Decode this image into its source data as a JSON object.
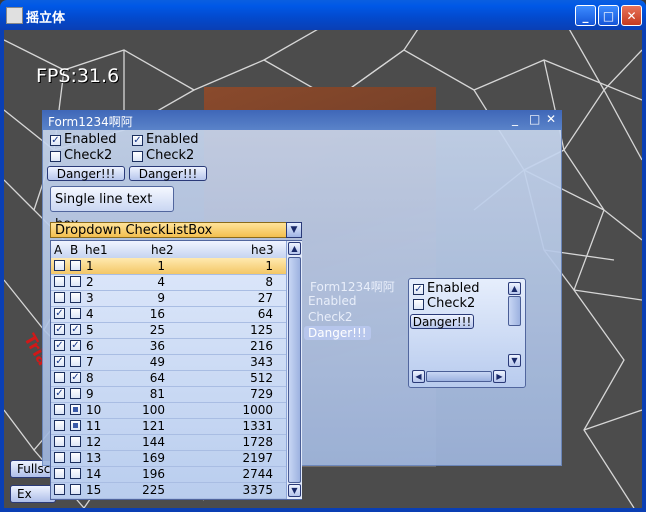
{
  "window": {
    "title": "摇立体",
    "min": "_",
    "max": "□",
    "close": "✕"
  },
  "scene": {
    "fps": "FPS:31.6",
    "red_text": "Tria",
    "fullscreen_label": "Fullsc",
    "exit_label": "Ex"
  },
  "form": {
    "title": "Form1234啊阿",
    "col1": {
      "enabled": "Enabled",
      "check2": "Check2",
      "danger": "Danger!!!"
    },
    "col2": {
      "enabled": "Enabled",
      "check2": "Check2",
      "danger": "Danger!!!"
    },
    "textbox": "Single line text box",
    "dropdown": "Dropdown CheckListBox",
    "grid": {
      "headers": [
        "A",
        "B",
        "he1",
        "he2",
        "he3"
      ],
      "rows": [
        {
          "a": false,
          "b": false,
          "he1": "1",
          "he2": "1",
          "he3": "1"
        },
        {
          "a": false,
          "b": false,
          "he1": "2",
          "he2": "4",
          "he3": "8"
        },
        {
          "a": false,
          "b": false,
          "he1": "3",
          "he2": "9",
          "he3": "27"
        },
        {
          "a": true,
          "b": false,
          "he1": "4",
          "he2": "16",
          "he3": "64"
        },
        {
          "a": true,
          "b": true,
          "he1": "5",
          "he2": "25",
          "he3": "125"
        },
        {
          "a": true,
          "b": true,
          "he1": "6",
          "he2": "36",
          "he3": "216"
        },
        {
          "a": true,
          "b": false,
          "he1": "7",
          "he2": "49",
          "he3": "343"
        },
        {
          "a": false,
          "b": true,
          "he1": "8",
          "he2": "64",
          "he3": "512"
        },
        {
          "a": true,
          "b": false,
          "he1": "9",
          "he2": "81",
          "he3": "729"
        },
        {
          "a": false,
          "b": "partial",
          "he1": "10",
          "he2": "100",
          "he3": "1000"
        },
        {
          "a": false,
          "b": "partial",
          "he1": "11",
          "he2": "121",
          "he3": "1331"
        },
        {
          "a": false,
          "b": false,
          "he1": "12",
          "he2": "144",
          "he3": "1728"
        },
        {
          "a": false,
          "b": false,
          "he1": "13",
          "he2": "169",
          "he3": "2197"
        },
        {
          "a": false,
          "b": false,
          "he1": "14",
          "he2": "196",
          "he3": "2744"
        },
        {
          "a": false,
          "b": false,
          "he1": "15",
          "he2": "225",
          "he3": "3375"
        }
      ]
    },
    "ghost": {
      "title": "Form1234啊阿",
      "enabled": "Enabled",
      "check2": "Check2",
      "danger": "Danger!!!"
    },
    "panel": {
      "enabled": "Enabled",
      "check2": "Check2",
      "danger": "Danger!!!"
    }
  },
  "colors": {
    "selected_row": "#f3c766",
    "dropdown": "#ffe39a",
    "title_bar": "#0058e6",
    "red_text": "#d21818"
  }
}
